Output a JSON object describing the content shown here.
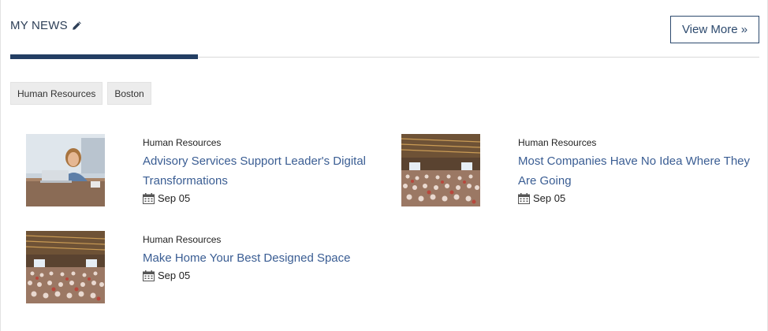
{
  "section": {
    "title": "MY NEWS",
    "view_more_label": "View More »"
  },
  "filters": [
    {
      "label": "Human Resources"
    },
    {
      "label": "Boston"
    }
  ],
  "news": [
    {
      "category": "Human Resources",
      "headline": "Advisory Services Support Leader's Digital Transformations",
      "date": "Sep 05",
      "image": "woman-laptop-photo"
    },
    {
      "category": "Human Resources",
      "headline": "Most Companies Have No Idea Where They Are Going",
      "date": "Sep 05",
      "image": "conference-hall-photo"
    },
    {
      "category": "Human Resources",
      "headline": "Make Home Your Best Designed Space",
      "date": "Sep 05",
      "image": "conference-hall-photo"
    }
  ],
  "colors": {
    "accent": "#233e63",
    "link": "#3a5d93",
    "chip_bg": "#ececec"
  }
}
